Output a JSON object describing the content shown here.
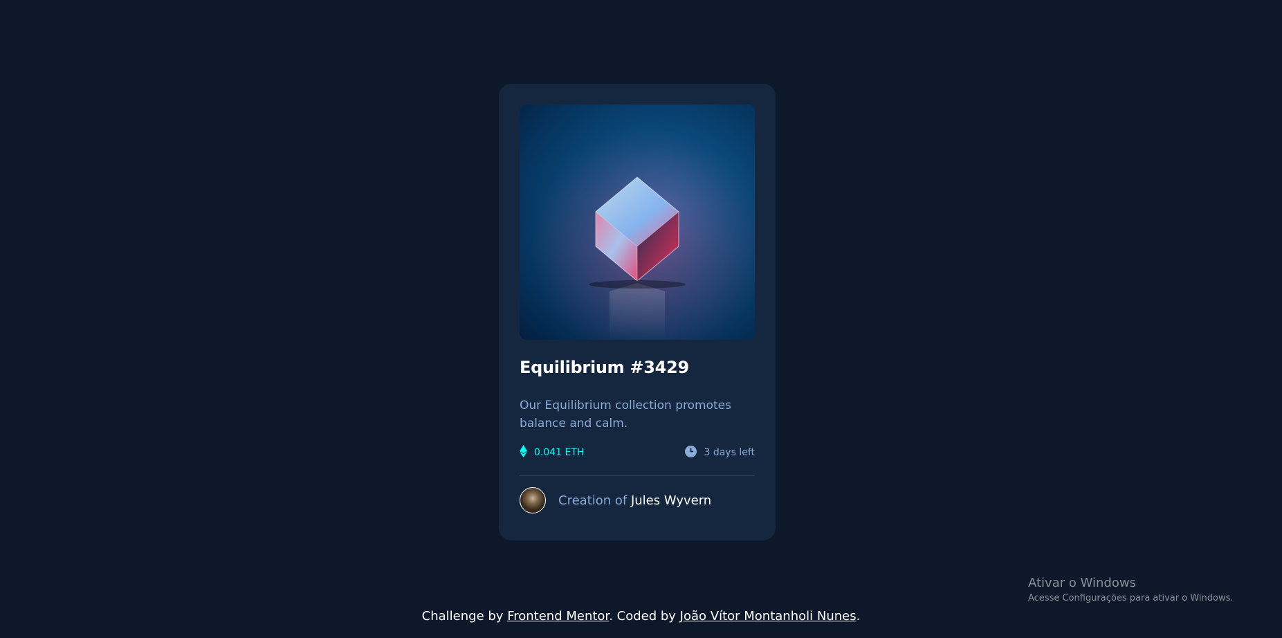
{
  "card": {
    "image_alt": "Equilibrium cube image",
    "title": "Equilibrium #3429",
    "description": "Our Equilibrium collection promotes balance and calm.",
    "price": {
      "icon": "ethereum-icon",
      "label": "0.041 ETH"
    },
    "time": {
      "icon": "clock-icon",
      "label": "3 days left"
    },
    "creator": {
      "prefix": "Creation of",
      "name": "Jules Wyvern"
    }
  },
  "footer": {
    "text_1": "Challenge by ",
    "link_1": "Frontend Mentor",
    "text_2": ". Coded by ",
    "link_2": "João Vítor Montanholi Nunes",
    "text_3": "."
  },
  "watermark": {
    "title": "Ativar o Windows",
    "subtitle": "Acesse Configurações para ativar o Windows."
  },
  "colors": {
    "page_bg": "#0d192b",
    "card_bg": "#15263f",
    "accent_cyan": "#00fff8",
    "soft_blue": "#8bacd9",
    "white": "#ffffff"
  }
}
